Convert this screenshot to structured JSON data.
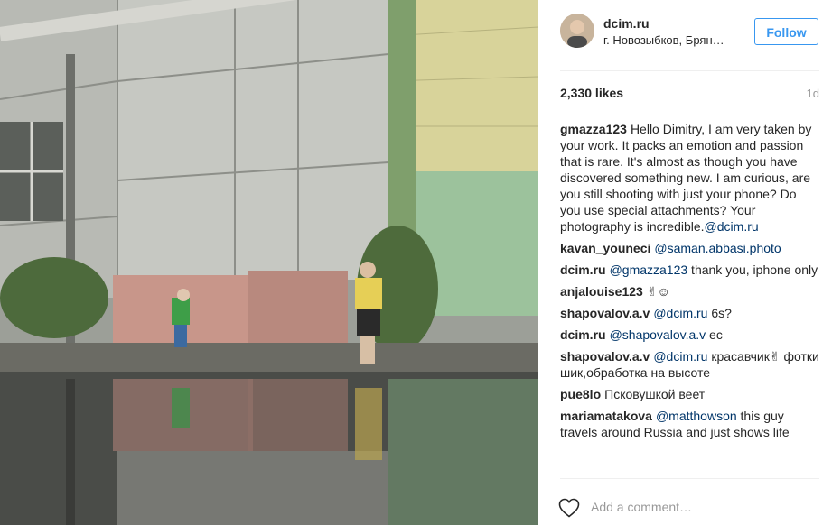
{
  "post": {
    "username": "dcim.ru",
    "location": "г. Новозыбков, Брян…",
    "follow_label": "Follow",
    "likes": "2,330 likes",
    "time_ago": "1d"
  },
  "comments": [
    {
      "author": "gmazza123",
      "parts": [
        {
          "text": "Hello Dimitry, I am very taken by your work. It packs an emotion and passion that is rare. It's almost as though you have discovered something new. I am curious, are you still shooting with just your phone? Do you use special attachments? Your photography is incredible.",
          "mention": false
        },
        {
          "text": "@dcim.ru",
          "mention": true
        }
      ]
    },
    {
      "author": "kavan_youneci",
      "parts": [
        {
          "text": "@saman.abbasi.photo",
          "mention": true
        }
      ]
    },
    {
      "author": "dcim.ru",
      "parts": [
        {
          "text": "@gmazza123",
          "mention": true
        },
        {
          "text": " thank you, iphone only",
          "mention": false
        }
      ]
    },
    {
      "author": "anjalouise123",
      "parts": [
        {
          "text": "✌︎☺",
          "mention": false
        }
      ]
    },
    {
      "author": "shapovalov.a.v",
      "parts": [
        {
          "text": "@dcim.ru",
          "mention": true
        },
        {
          "text": " 6s?",
          "mention": false
        }
      ]
    },
    {
      "author": "dcim.ru",
      "parts": [
        {
          "text": "@shapovalov.a.v",
          "mention": true
        },
        {
          "text": " ес",
          "mention": false
        }
      ]
    },
    {
      "author": "shapovalov.a.v",
      "parts": [
        {
          "text": "@dcim.ru",
          "mention": true
        },
        {
          "text": " красавчик✌︎ фотки шик,обработка на высоте",
          "mention": false
        }
      ]
    },
    {
      "author": "pue8lo",
      "parts": [
        {
          "text": "Псковушкой веет",
          "mention": false
        }
      ]
    },
    {
      "author": "mariamatakova",
      "parts": [
        {
          "text": "@matthowson",
          "mention": true
        },
        {
          "text": " this guy travels around Russia and just shows life",
          "mention": false
        }
      ]
    }
  ],
  "add_comment": {
    "placeholder": "Add a comment…"
  },
  "icons": {
    "like": "heart-icon",
    "avatar": "avatar"
  },
  "colors": {
    "follow_blue": "#3897f0",
    "mention_blue": "#003569",
    "muted": "#999999"
  }
}
